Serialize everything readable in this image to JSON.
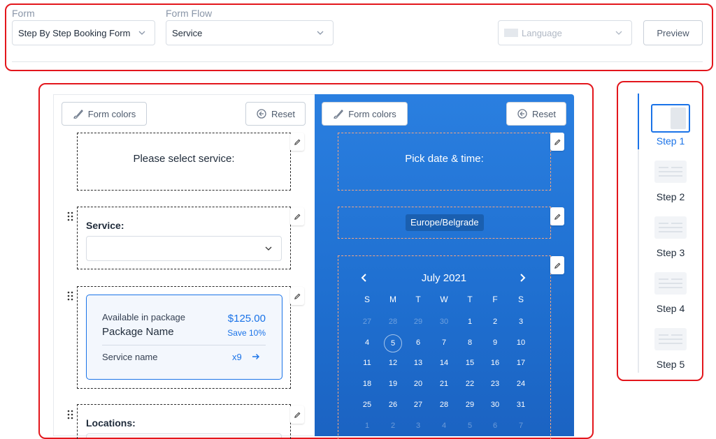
{
  "header": {
    "form_label": "Form",
    "form_value": "Step By Step Booking Form",
    "flow_label": "Form Flow",
    "flow_value": "Service",
    "language_placeholder": "Language",
    "preview_label": "Preview"
  },
  "left_panel": {
    "form_colors_label": "Form colors",
    "reset_label": "Reset",
    "title_text": "Please select service:",
    "service_label": "Service:",
    "package": {
      "available": "Available in package",
      "name": "Package Name",
      "price": "$125.00",
      "save": "Save 10%",
      "service_name": "Service name",
      "qty": "x9"
    },
    "locations_label": "Locations:"
  },
  "right_panel": {
    "form_colors_label": "Form colors",
    "reset_label": "Reset",
    "title_text": "Pick date & time:",
    "timezone": "Europe/Belgrade",
    "calendar": {
      "month": "July 2021",
      "weekdays": [
        "S",
        "M",
        "T",
        "W",
        "T",
        "F",
        "S"
      ],
      "rows": [
        [
          "27",
          "28",
          "29",
          "30",
          "1",
          "2",
          "3"
        ],
        [
          "4",
          "5",
          "6",
          "7",
          "8",
          "9",
          "10"
        ],
        [
          "11",
          "12",
          "13",
          "14",
          "15",
          "16",
          "17"
        ],
        [
          "18",
          "19",
          "20",
          "21",
          "22",
          "23",
          "24"
        ],
        [
          "25",
          "26",
          "27",
          "28",
          "29",
          "30",
          "31"
        ],
        [
          "1",
          "2",
          "3",
          "4",
          "5",
          "6",
          "7"
        ]
      ],
      "selected_day": "5"
    }
  },
  "steps": [
    {
      "label": "Step 1",
      "active": true
    },
    {
      "label": "Step 2",
      "active": false
    },
    {
      "label": "Step 3",
      "active": false
    },
    {
      "label": "Step 4",
      "active": false
    },
    {
      "label": "Step 5",
      "active": false
    }
  ],
  "colors": {
    "accent": "#1a73e8",
    "annotation_red": "#e3161c",
    "panel_blue": "#2a7fe0",
    "price_blue": "#1a73e8"
  }
}
